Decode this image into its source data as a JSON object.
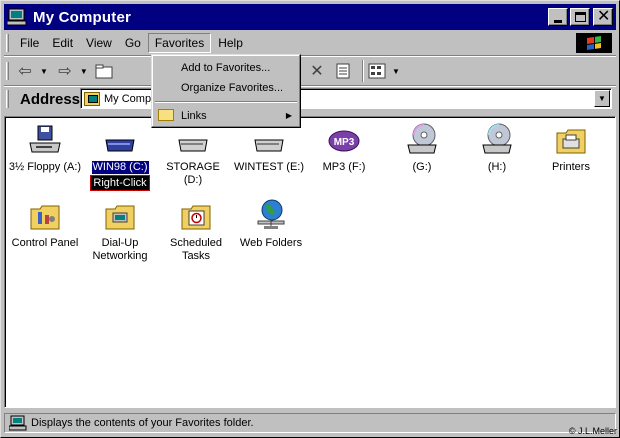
{
  "window": {
    "title": "My Computer"
  },
  "menubar": {
    "items": [
      "File",
      "Edit",
      "View",
      "Go",
      "Favorites",
      "Help"
    ],
    "active": "Favorites"
  },
  "favorites_menu": {
    "items": [
      {
        "label": "Add to Favorites...",
        "icon": "none"
      },
      {
        "label": "Organize Favorites...",
        "icon": "none"
      },
      {
        "label": "Links",
        "icon": "folder-icon",
        "submenu": true
      }
    ]
  },
  "address": {
    "label": "Address",
    "value": "My Compu"
  },
  "drives": [
    {
      "label": "3½ Floppy (A:)",
      "icon": "floppy-drive-icon"
    },
    {
      "label": "WIN98 (C:)",
      "icon": "hard-drive-icon",
      "selected": true,
      "tag": "Right-Click"
    },
    {
      "label": "STORAGE (D:)",
      "icon": "hard-drive-icon"
    },
    {
      "label": "WINTEST (E:)",
      "icon": "hard-drive-icon"
    },
    {
      "label": "MP3 (F:)",
      "icon": "mp3-drive-icon"
    },
    {
      "label": "(G:)",
      "icon": "cd-drive-icon"
    },
    {
      "label": "(H:)",
      "icon": "cd-drive-icon"
    },
    {
      "label": "Printers",
      "icon": "printer-folder-icon"
    }
  ],
  "folders": [
    {
      "label": "Control Panel",
      "icon": "control-panel-icon"
    },
    {
      "label": "Dial-Up Networking",
      "icon": "dialup-networking-icon"
    },
    {
      "label": "Scheduled Tasks",
      "icon": "scheduled-tasks-icon"
    },
    {
      "label": "Web Folders",
      "icon": "web-folders-icon"
    }
  ],
  "status": {
    "text": "Displays the contents of your Favorites folder.",
    "copyright": "© J.L.Meller"
  },
  "colors": {
    "titlebar": "#000080",
    "face": "#c0c0c0",
    "selection": "#000080"
  }
}
